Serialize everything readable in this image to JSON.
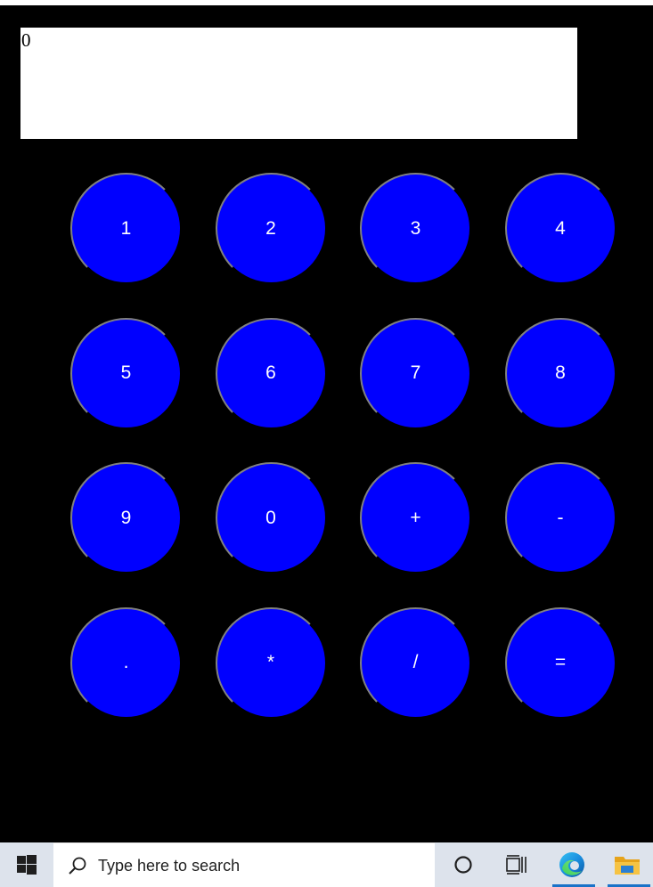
{
  "display": {
    "value": "0"
  },
  "keypad": {
    "keys": [
      {
        "label": "1",
        "name": "key-1"
      },
      {
        "label": "2",
        "name": "key-2"
      },
      {
        "label": "3",
        "name": "key-3"
      },
      {
        "label": "4",
        "name": "key-4"
      },
      {
        "label": "5",
        "name": "key-5"
      },
      {
        "label": "6",
        "name": "key-6"
      },
      {
        "label": "7",
        "name": "key-7"
      },
      {
        "label": "8",
        "name": "key-8"
      },
      {
        "label": "9",
        "name": "key-9"
      },
      {
        "label": "0",
        "name": "key-0"
      },
      {
        "label": "+",
        "name": "key-plus"
      },
      {
        "label": "-",
        "name": "key-minus"
      },
      {
        "label": ".",
        "name": "key-decimal"
      },
      {
        "label": "*",
        "name": "key-multiply"
      },
      {
        "label": "/",
        "name": "key-divide"
      },
      {
        "label": "=",
        "name": "key-equals"
      }
    ]
  },
  "colors": {
    "background": "#000000",
    "key_fill": "#0000ff",
    "key_text": "#ffffff",
    "display_bg": "#ffffff"
  },
  "taskbar": {
    "search_placeholder": "Type here to search",
    "icons": [
      "windows-start-icon",
      "search-icon",
      "cortana-icon",
      "task-view-icon",
      "edge-browser-icon",
      "file-explorer-icon"
    ]
  }
}
